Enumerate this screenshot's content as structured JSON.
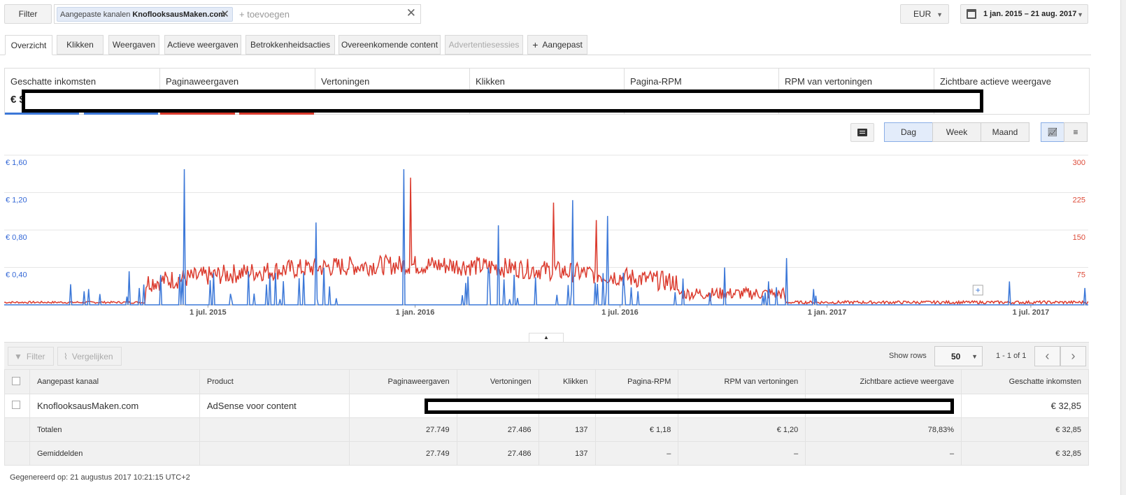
{
  "toolbar": {
    "filter_label": "Filter",
    "chip_prefix": "Aangepaste kanalen",
    "chip_value": "KnoflooksausMaken.com",
    "add_placeholder": "+ toevoegen",
    "currency": "EUR",
    "date_range": "1 jan. 2015 – 21 aug. 2017"
  },
  "tabs": [
    "Overzicht",
    "Klikken",
    "Weergaven",
    "Actieve weergaven",
    "Betrokkenheidsacties",
    "Overeenkomende content",
    "Advertentiesessies",
    "Aangepast"
  ],
  "metrics": {
    "labels": [
      "Geschatte inkomsten",
      "Paginaweergaven",
      "Vertoningen",
      "Klikken",
      "Pagina-RPM",
      "RPM van vertoningen",
      "Zichtbare actieve weergave"
    ],
    "first_value_visible": "€ $"
  },
  "chart_controls": {
    "day": "Dag",
    "week": "Week",
    "month": "Maand"
  },
  "colors": {
    "blue": "#3c78d8",
    "red": "#db3b2e"
  },
  "chart_data": {
    "type": "line",
    "left_axis": {
      "ticks": [
        "€ 1,60",
        "€ 1,20",
        "€ 0,80",
        "€ 0,40"
      ]
    },
    "right_axis": {
      "ticks": [
        "300",
        "225",
        "150",
        "75"
      ]
    },
    "x_ticks": [
      "1 jul. 2015",
      "1 jan. 2016",
      "1 jul. 2016",
      "1 jan. 2017",
      "1 jul. 2017"
    ],
    "series": [
      {
        "axis": "left",
        "description": "Geschatte inkomsten (daily, mostly 0 with spikes)",
        "spikes": [
          {
            "date": "2015-03-01",
            "value": 0.22
          },
          {
            "date": "2015-05-01",
            "value": 0.18
          },
          {
            "date": "2015-06-10",
            "value": 1.45
          },
          {
            "date": "2015-10-05",
            "value": 0.88
          },
          {
            "date": "2015-12-22",
            "value": 1.45
          },
          {
            "date": "2016-03-15",
            "value": 0.85
          },
          {
            "date": "2016-05-20",
            "value": 1.12
          },
          {
            "date": "2016-06-20",
            "value": 0.95
          },
          {
            "date": "2016-10-02",
            "value": 0.4
          },
          {
            "date": "2016-11-26",
            "value": 0.5
          },
          {
            "date": "2017-06-12",
            "value": 0.25
          },
          {
            "date": "2017-08-18",
            "value": 0.18
          }
        ]
      },
      {
        "axis": "right",
        "description": "Paginaweergaven (daily)",
        "peaks": [
          {
            "date": "2015-12-28",
            "value": 255
          },
          {
            "date": "2016-05-03",
            "value": 205
          },
          {
            "date": "2016-06-10",
            "value": 170
          }
        ]
      }
    ]
  },
  "table": {
    "filter_btn": "Filter",
    "compare_btn": "Vergelijken",
    "show_rows_label": "Show rows",
    "rows_value": "50",
    "range": "1 - 1 of 1",
    "headers": [
      "Aangepast kanaal",
      "Product",
      "Paginaweergaven",
      "Vertoningen",
      "Klikken",
      "Pagina-RPM",
      "RPM van vertoningen",
      "Zichtbare actieve weergave",
      "Geschatte inkomsten"
    ],
    "row": {
      "channel": "KnoflooksausMaken.com",
      "product": "AdSense voor content",
      "income": "€ 32,85"
    },
    "totals": {
      "label": "Totalen",
      "values": [
        "27.749",
        "27.486",
        "137",
        "€ 1,18",
        "€ 1,20",
        "78,83%",
        "€ 32,85"
      ]
    },
    "averages": {
      "label": "Gemiddelden",
      "values": [
        "27.749",
        "27.486",
        "137",
        "–",
        "–",
        "–",
        "€ 32,85"
      ]
    }
  },
  "footer": "Gegenereerd op: 21 augustus 2017 10:21:15 UTC+2"
}
